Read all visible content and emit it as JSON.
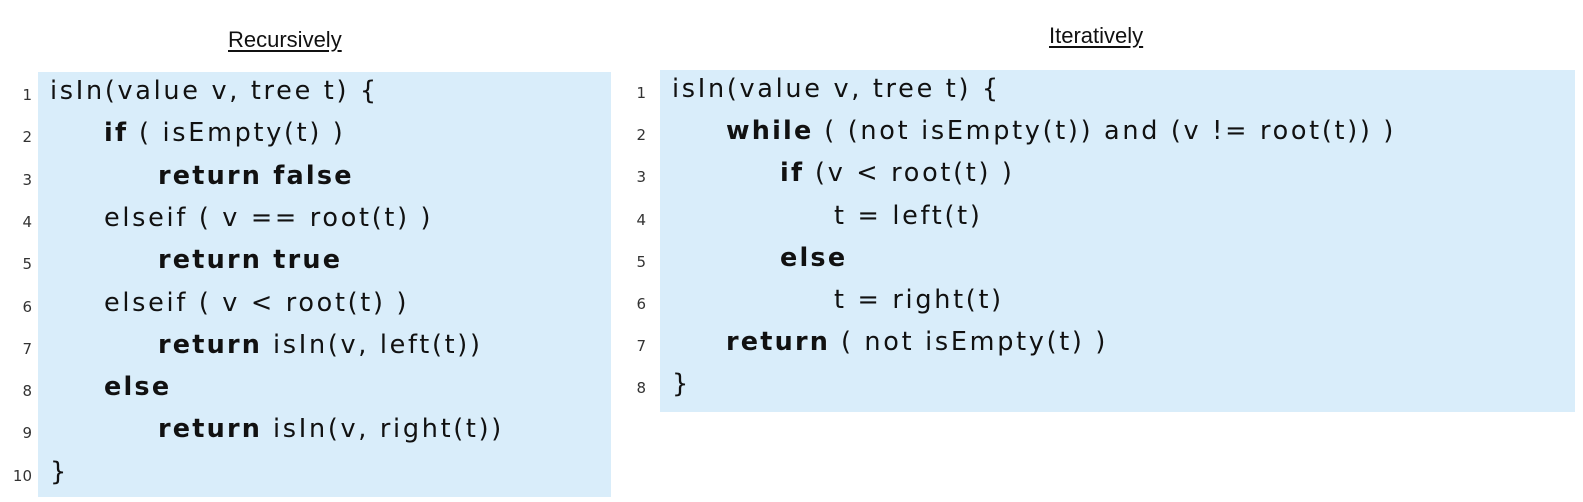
{
  "left_panel": {
    "title": "Recursively",
    "line_numbers": [
      "1",
      "2",
      "3",
      "4",
      "5",
      "6",
      "7",
      "8",
      "9",
      "10"
    ],
    "lines": [
      [
        {
          "t": "isIn(value v, tree t) {",
          "k": false
        }
      ],
      [
        {
          "t": "if",
          "k": true
        },
        {
          "t": " ( isEmpty(t) )",
          "k": false
        }
      ],
      [
        {
          "t": "return false",
          "k": true
        }
      ],
      [
        {
          "t": "elseif ( v == root(t) )",
          "k": false
        }
      ],
      [
        {
          "t": "return true",
          "k": true
        }
      ],
      [
        {
          "t": "elseif ( v < root(t) )",
          "k": false
        }
      ],
      [
        {
          "t": "return",
          "k": true
        },
        {
          "t": " isIn(v, left(t))",
          "k": false
        }
      ],
      [
        {
          "t": "else",
          "k": true
        }
      ],
      [
        {
          "t": "return",
          "k": true
        },
        {
          "t": " isIn(v, right(t))",
          "k": false
        }
      ],
      [
        {
          "t": "}",
          "k": false
        }
      ]
    ],
    "indents": [
      0,
      1,
      2,
      1,
      2,
      1,
      2,
      1,
      2,
      0
    ]
  },
  "right_panel": {
    "title": "Iteratively",
    "line_numbers": [
      "1",
      "2",
      "3",
      "4",
      "5",
      "6",
      "7",
      "8"
    ],
    "lines": [
      [
        {
          "t": "isIn(value v, tree t) {",
          "k": false
        }
      ],
      [
        {
          "t": "while",
          "k": true
        },
        {
          "t": " ( (not isEmpty(t)) and (v != root(t)) )",
          "k": false
        }
      ],
      [
        {
          "t": "if",
          "k": true
        },
        {
          "t": " (v < root(t) )",
          "k": false
        }
      ],
      [
        {
          "t": "t = left(t)",
          "k": false
        }
      ],
      [
        {
          "t": "else",
          "k": true
        }
      ],
      [
        {
          "t": "t = right(t)",
          "k": false
        }
      ],
      [
        {
          "t": "return",
          "k": true
        },
        {
          "t": " ( not isEmpty(t) )",
          "k": false
        }
      ],
      [
        {
          "t": "}",
          "k": false
        }
      ]
    ],
    "indents": [
      0,
      1,
      2,
      3,
      2,
      3,
      1,
      0
    ]
  },
  "colors": {
    "code_background": "#d9edfa",
    "text": "#111111",
    "line_number": "#333333"
  }
}
